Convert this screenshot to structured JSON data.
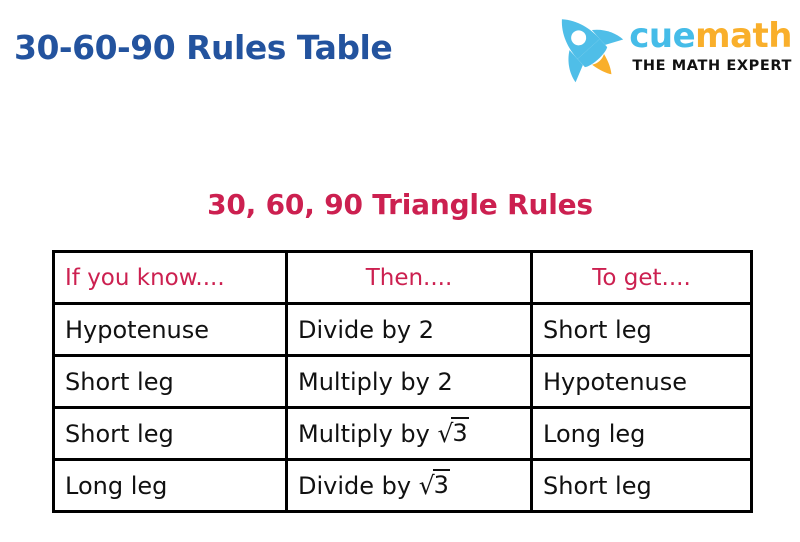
{
  "header": {
    "title": "30-60-90 Rules Table",
    "brand": {
      "word_primary": "cue",
      "word_secondary": "math",
      "tagline": "THE MATH EXPERT",
      "icon": "rocket-icon",
      "colors": {
        "rocket_body": "#4FBEE8",
        "rocket_flame": "#F9AF2B",
        "cue": "#45BCE8",
        "math": "#F9AF2B",
        "tagline": "#111111"
      }
    },
    "title_color": "#23539E"
  },
  "table": {
    "title": "30, 60, 90 Triangle Rules",
    "title_color": "#CC2050",
    "header_color": "#CC2050",
    "border_color": "#000000",
    "columns": [
      {
        "key": "know",
        "label": "If you know...."
      },
      {
        "key": "then",
        "label": "Then...."
      },
      {
        "key": "get",
        "label": "To get...."
      }
    ],
    "rows": [
      {
        "know": "Hypotenuse",
        "then_prefix": "Divide by ",
        "then_value": "2",
        "then_radical": false,
        "get": "Short leg"
      },
      {
        "know": "Short leg",
        "then_prefix": "Multiply by ",
        "then_value": "2",
        "then_radical": false,
        "get": "Hypotenuse"
      },
      {
        "know": "Short leg",
        "then_prefix": "Multiply by ",
        "then_value": "3",
        "then_radical": true,
        "get": "Long leg"
      },
      {
        "know": "Long leg",
        "then_prefix": "Divide by ",
        "then_value": "3",
        "then_radical": true,
        "get": "Short leg"
      }
    ]
  }
}
